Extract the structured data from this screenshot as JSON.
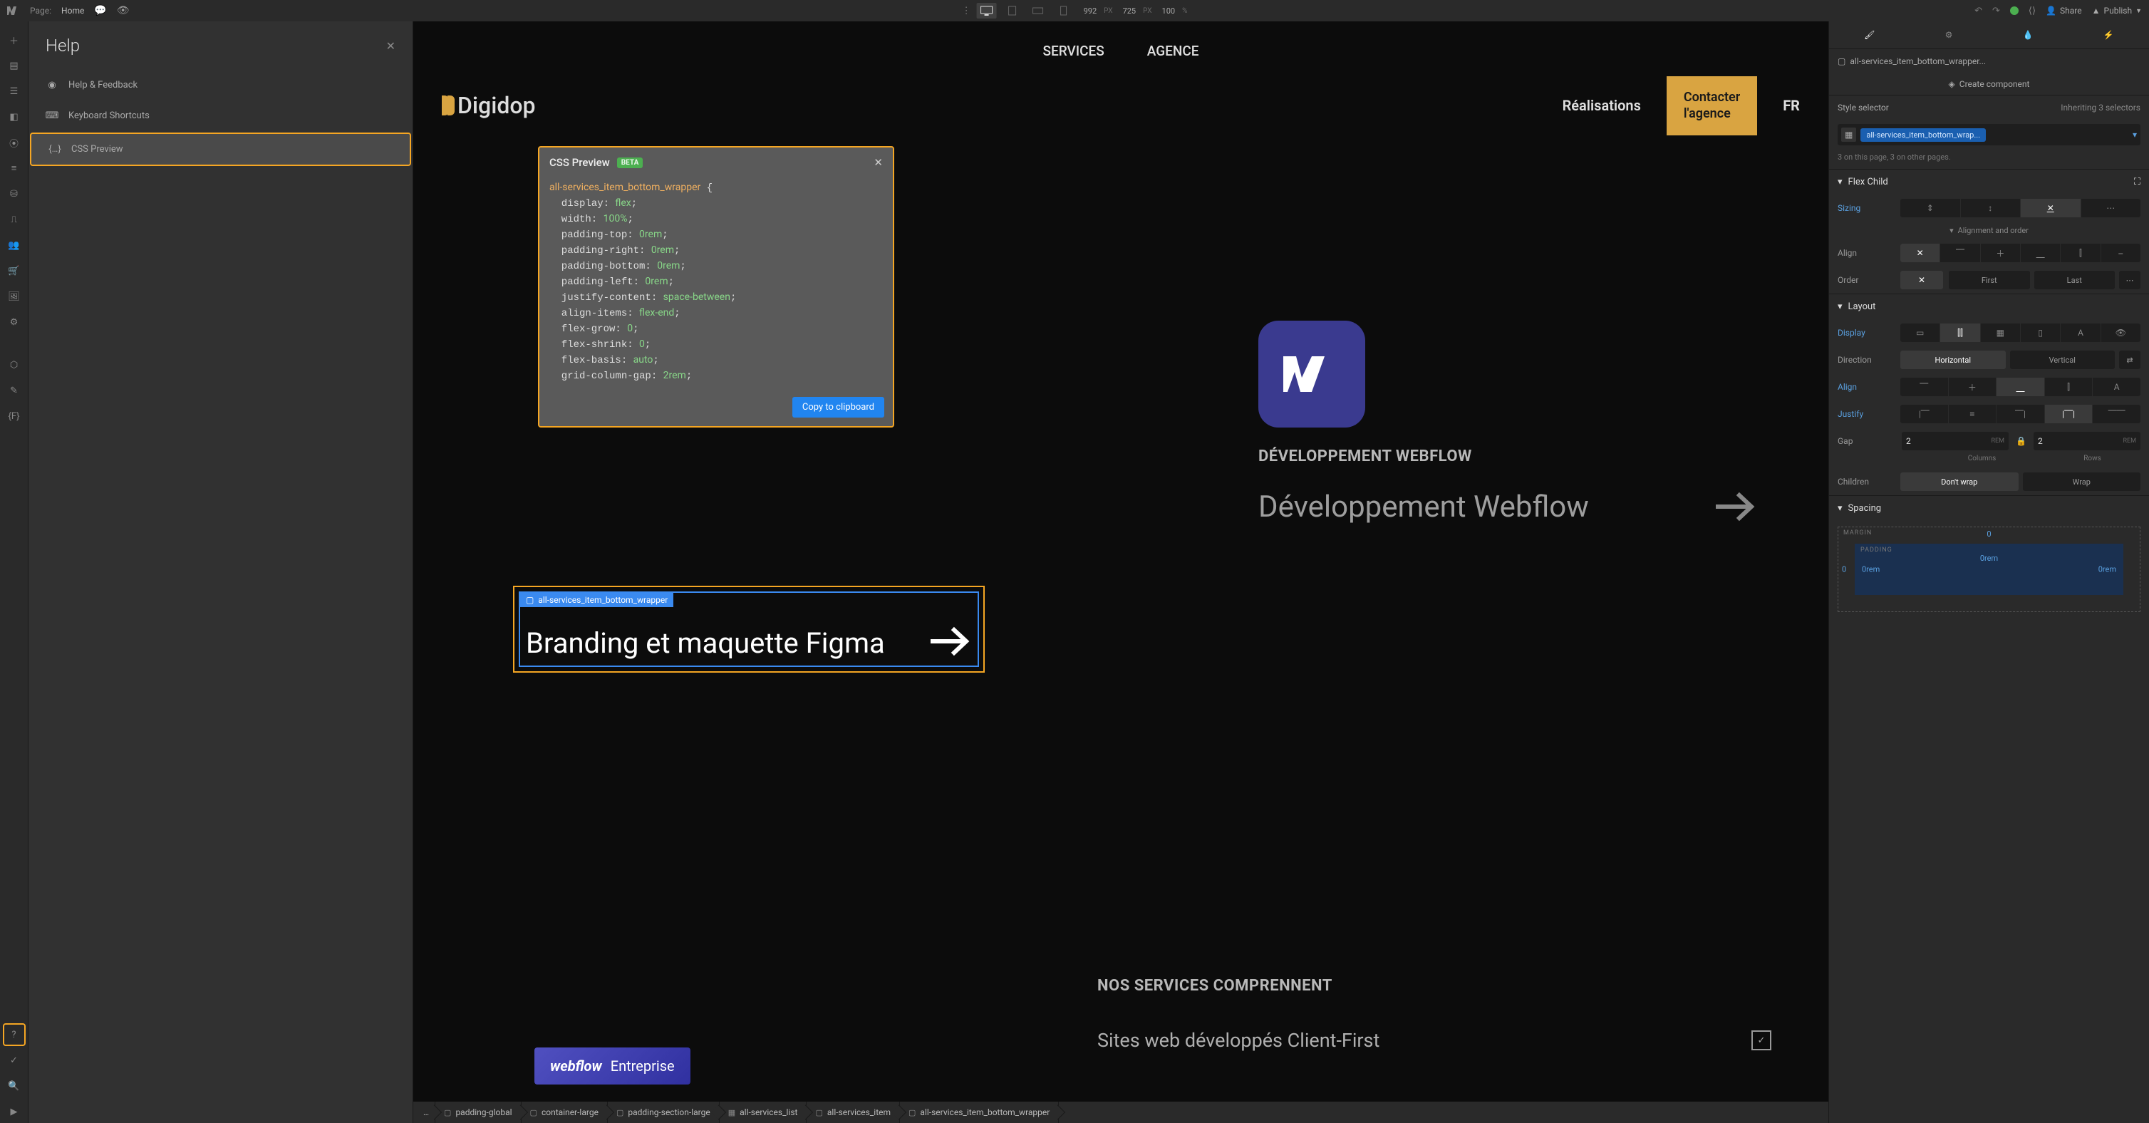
{
  "topbar": {
    "page_label": "Page:",
    "page_name": "Home",
    "width_val": "992",
    "px": "PX",
    "height_val": "725",
    "zoom_val": "100",
    "pct": "%",
    "share": "Share",
    "publish": "Publish"
  },
  "help_panel": {
    "title": "Help",
    "feedback": "Help & Feedback",
    "shortcuts": "Keyboard Shortcuts",
    "css_preview": "CSS Preview"
  },
  "css_popover": {
    "title": "CSS Preview",
    "beta": "BETA",
    "selector": "all-services_item_bottom_wrapper",
    "rules": [
      {
        "p": "display",
        "v": "flex"
      },
      {
        "p": "width",
        "v": "100%"
      },
      {
        "p": "padding-top",
        "v": "0rem"
      },
      {
        "p": "padding-right",
        "v": "0rem"
      },
      {
        "p": "padding-bottom",
        "v": "0rem"
      },
      {
        "p": "padding-left",
        "v": "0rem"
      },
      {
        "p": "justify-content",
        "v": "space-between"
      },
      {
        "p": "align-items",
        "v": "flex-end"
      },
      {
        "p": "flex-grow",
        "v": "0"
      },
      {
        "p": "flex-shrink",
        "v": "0"
      },
      {
        "p": "flex-basis",
        "v": "auto"
      },
      {
        "p": "grid-column-gap",
        "v": "2rem"
      }
    ],
    "copy": "Copy to clipboard"
  },
  "site": {
    "nav_services": "SERVICES",
    "nav_agence": "AGENCE",
    "brand": "Digidop",
    "realisations": "Réalisations",
    "cta_l1": "Contacter",
    "cta_l2": "l'agence",
    "lang": "FR"
  },
  "selection": {
    "tag": "all-services_item_bottom_wrapper",
    "text": "Branding et maquette Figma"
  },
  "svc": {
    "label": "DÉVELOPPEMENT WEBFLOW",
    "title": "Développement Webflow"
  },
  "comprennent": "NOS SERVICES COMPRENNENT",
  "clientfirst": "Sites web développés Client-First",
  "wf_enterprise": {
    "logo": "webflow",
    "text": "Entreprise"
  },
  "breadcrumbs": [
    "padding-global",
    "container-large",
    "padding-section-large",
    "all-services_list",
    "all-services_item",
    "all-services_item_bottom_wrapper"
  ],
  "rpanel": {
    "selector_label": "all-services_item_bottom_wrapper...",
    "create_comp": "Create component",
    "style_selector": "Style selector",
    "inheriting": "Inheriting 3 selectors",
    "pill": "all-services_item_bottom_wrap...",
    "count": "3 on this page, 3 on other pages.",
    "sec_flexchild": "Flex Child",
    "sizing": "Sizing",
    "align_order": "Alignment and order",
    "align_label": "Align",
    "order_label": "Order",
    "order_first": "First",
    "order_last": "Last",
    "sec_layout": "Layout",
    "display": "Display",
    "direction": "Direction",
    "dir_h": "Horizontal",
    "dir_v": "Vertical",
    "align2": "Align",
    "justify": "Justify",
    "gap": "Gap",
    "gap_col_v": "2",
    "gap_row_v": "2",
    "gap_unit": "REM",
    "gap_cols": "Columns",
    "gap_rows": "Rows",
    "children": "Children",
    "nowrap": "Don't wrap",
    "wrap": "Wrap",
    "sec_spacing": "Spacing",
    "margin": "MARGIN",
    "padding": "PADDING",
    "m0": "0",
    "p0": "0rem"
  }
}
